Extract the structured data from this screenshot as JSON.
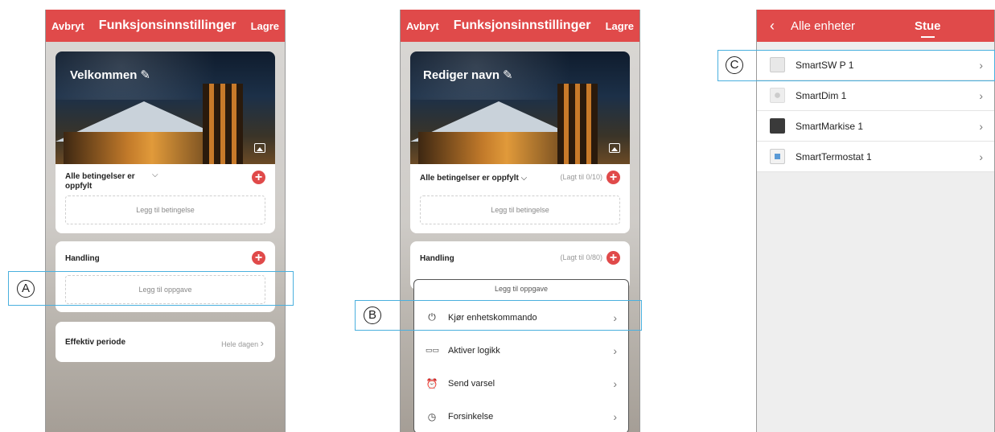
{
  "panel1": {
    "cancel": "Avbryt",
    "title": "Funksjonsinnstillinger",
    "save": "Lagre",
    "scene_name": "Velkommen",
    "pen_icon": "pencil-icon",
    "conditions_label": "Alle betingelser er oppfylt",
    "add_condition": "Legg til betingelse",
    "action_label": "Handling",
    "add_task": "Legg til oppgave",
    "period_label": "Effektiv periode",
    "period_value": "Hele dagen",
    "marker": "A"
  },
  "panel2": {
    "cancel": "Avbryt",
    "title": "Funksjonsinnstillinger",
    "save": "Lagre",
    "scene_name": "Rediger navn",
    "conditions_label": "Alle betingelser er oppfylt",
    "conditions_count": "(Lagt til 0/10)",
    "add_condition": "Legg til betingelse",
    "action_label": "Handling",
    "action_count": "(Lagt til 0/80)",
    "menu_title": "Legg til oppgave",
    "menu_items": [
      {
        "label": "Kjør enhetskommando",
        "icon": "power-icon"
      },
      {
        "label": "Aktiver logikk",
        "icon": "logic-icon"
      },
      {
        "label": "Send varsel",
        "icon": "alarm-icon"
      },
      {
        "label": "Forsinkelse",
        "icon": "clock-icon"
      }
    ],
    "marker": "B"
  },
  "panel3": {
    "back_icon": "back-chevron-icon",
    "tab_all": "Alle enheter",
    "tab_room": "Stue",
    "devices": [
      "SmartSW P 1",
      "SmartDim 1",
      "SmartMarkise 1",
      "SmartTermostat 1"
    ],
    "marker": "C"
  },
  "colors": {
    "accent": "#e04a4a",
    "highlight": "#4ab0de"
  }
}
